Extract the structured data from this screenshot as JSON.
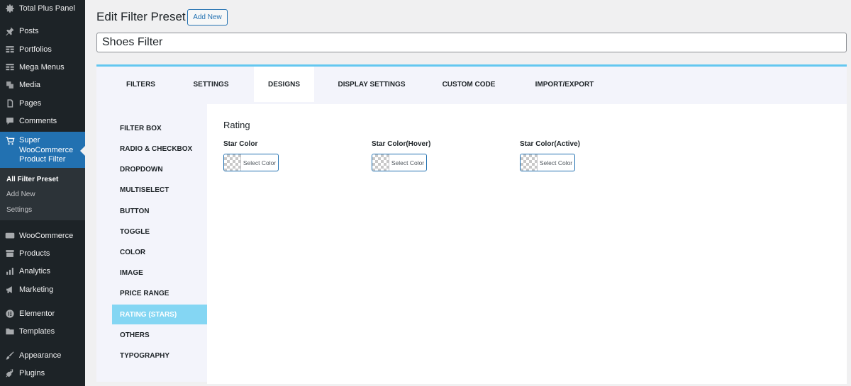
{
  "sidebar": {
    "items": [
      {
        "label": "Total Plus Panel",
        "icon": "gear-icon"
      },
      {
        "label": "Posts",
        "icon": "pin-icon"
      },
      {
        "label": "Portfolios",
        "icon": "grid-icon"
      },
      {
        "label": "Mega Menus",
        "icon": "grid-icon"
      },
      {
        "label": "Media",
        "icon": "media-icon"
      },
      {
        "label": "Pages",
        "icon": "page-icon"
      },
      {
        "label": "Comments",
        "icon": "comment-icon"
      },
      {
        "label": "WooCommerce",
        "icon": "woo-icon"
      },
      {
        "label": "Products",
        "icon": "archive-icon"
      },
      {
        "label": "Analytics",
        "icon": "bar-chart-icon"
      },
      {
        "label": "Marketing",
        "icon": "megaphone-icon"
      },
      {
        "label": "Elementor",
        "icon": "elementor-icon"
      },
      {
        "label": "Templates",
        "icon": "folder-icon"
      },
      {
        "label": "Appearance",
        "icon": "brush-icon"
      },
      {
        "label": "Plugins",
        "icon": "plug-icon"
      }
    ],
    "active": {
      "label": "Super WooCommerce Product Filter",
      "icon": "cart-icon"
    },
    "submenu": [
      "All Filter Preset",
      "Add New",
      "Settings"
    ]
  },
  "header": {
    "title": "Edit Filter Preset",
    "add_new": "Add New",
    "preset_name": "Shoes Filter"
  },
  "tabs": [
    "FILTERS",
    "SETTINGS",
    "DESIGNS",
    "DISPLAY SETTINGS",
    "CUSTOM CODE",
    "IMPORT/EXPORT"
  ],
  "active_tab": "DESIGNS",
  "design_menu": [
    "FILTER BOX",
    "RADIO & CHECKBOX",
    "DROPDOWN",
    "MULTISELECT",
    "BUTTON",
    "TOGGLE",
    "COLOR",
    "IMAGE",
    "PRICE RANGE",
    "RATING (STARS)",
    "OTHERS",
    "TYPOGRAPHY"
  ],
  "active_design": "RATING (STARS)",
  "section": {
    "title": "Rating",
    "fields": [
      {
        "label": "Star Color",
        "button": "Select Color"
      },
      {
        "label": "Star Color(Hover)",
        "button": "Select Color"
      },
      {
        "label": "Star Color(Active)",
        "button": "Select Color"
      }
    ]
  },
  "colors": {
    "sidebar_bg": "#1d2327",
    "active_menu": "#2271b1",
    "panel_accent": "#63c7f0",
    "active_design_bg": "#84d6f3"
  }
}
